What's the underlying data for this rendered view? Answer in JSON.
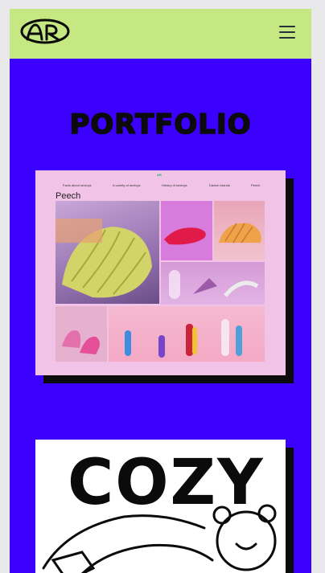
{
  "header": {
    "logo_text": "AR",
    "menu_icon": "hamburger-menu-icon",
    "background": "#c6e883"
  },
  "main": {
    "background": "#3c00ff",
    "title": "PORTFOLIO"
  },
  "projects": [
    {
      "name": "Peech",
      "nav": [
        "Facts about sextoys",
        "A variety of sextoys",
        "History of sextoys",
        "Danish brands",
        "Peech"
      ],
      "mini_logo": "AR",
      "brand": "Peech"
    },
    {
      "name": "Cozy",
      "headline": "COZY"
    }
  ]
}
